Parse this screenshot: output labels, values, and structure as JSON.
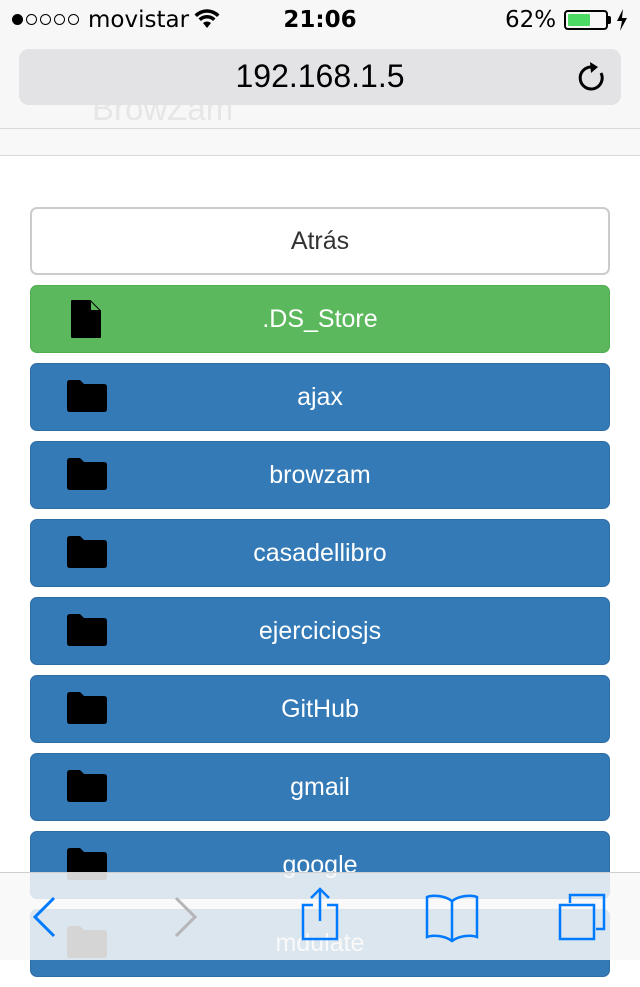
{
  "status": {
    "carrier": "movistar",
    "time": "21:06",
    "battery": "62%",
    "battery_level": 0.62,
    "signal_bars": 1
  },
  "browser": {
    "url": "192.168.1.5"
  },
  "page": {
    "ghost_title": "BrowZam"
  },
  "list": {
    "back_label": "Atrás",
    "items": [
      {
        "label": ".DS_Store",
        "type": "file"
      },
      {
        "label": "ajax",
        "type": "folder"
      },
      {
        "label": "browzam",
        "type": "folder"
      },
      {
        "label": "casadellibro",
        "type": "folder"
      },
      {
        "label": "ejerciciosjs",
        "type": "folder"
      },
      {
        "label": "GitHub",
        "type": "folder"
      },
      {
        "label": "gmail",
        "type": "folder"
      },
      {
        "label": "google",
        "type": "folder"
      },
      {
        "label": "mdulate",
        "type": "folder"
      }
    ]
  },
  "colors": {
    "folder_button": "#337ab7",
    "file_button": "#5cb85c",
    "ios_blue": "#007aff"
  }
}
